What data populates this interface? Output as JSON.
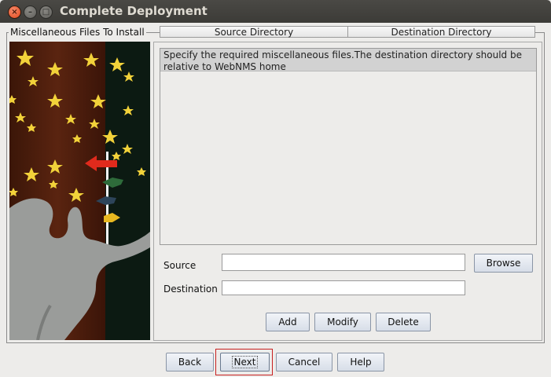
{
  "window": {
    "title": "Complete Deployment",
    "close_glyph": "×",
    "min_glyph": "–",
    "max_glyph": "□"
  },
  "group": {
    "legend": "Miscellaneous Files To Install"
  },
  "table": {
    "note": "Specify the required miscellaneous files.The destination directory should be relative to WebNMS home",
    "columns": [
      "Source Directory",
      "Destination Directory"
    ],
    "rows": []
  },
  "form": {
    "source_label": "Source",
    "source_value": "",
    "destination_label": "Destination",
    "destination_value": "",
    "browse_label": "Browse"
  },
  "actions": {
    "add": "Add",
    "modify": "Modify",
    "delete": "Delete"
  },
  "footer": {
    "back": "Back",
    "next": "Next",
    "cancel": "Cancel",
    "help": "Help"
  },
  "colors": {
    "focus_ring": "#c82020",
    "title_bar": "#3c3b37",
    "close_button": "#e2481b"
  },
  "icons": {
    "window_close": "close-icon",
    "window_minimize": "minimize-icon",
    "window_maximize": "maximize-icon"
  }
}
